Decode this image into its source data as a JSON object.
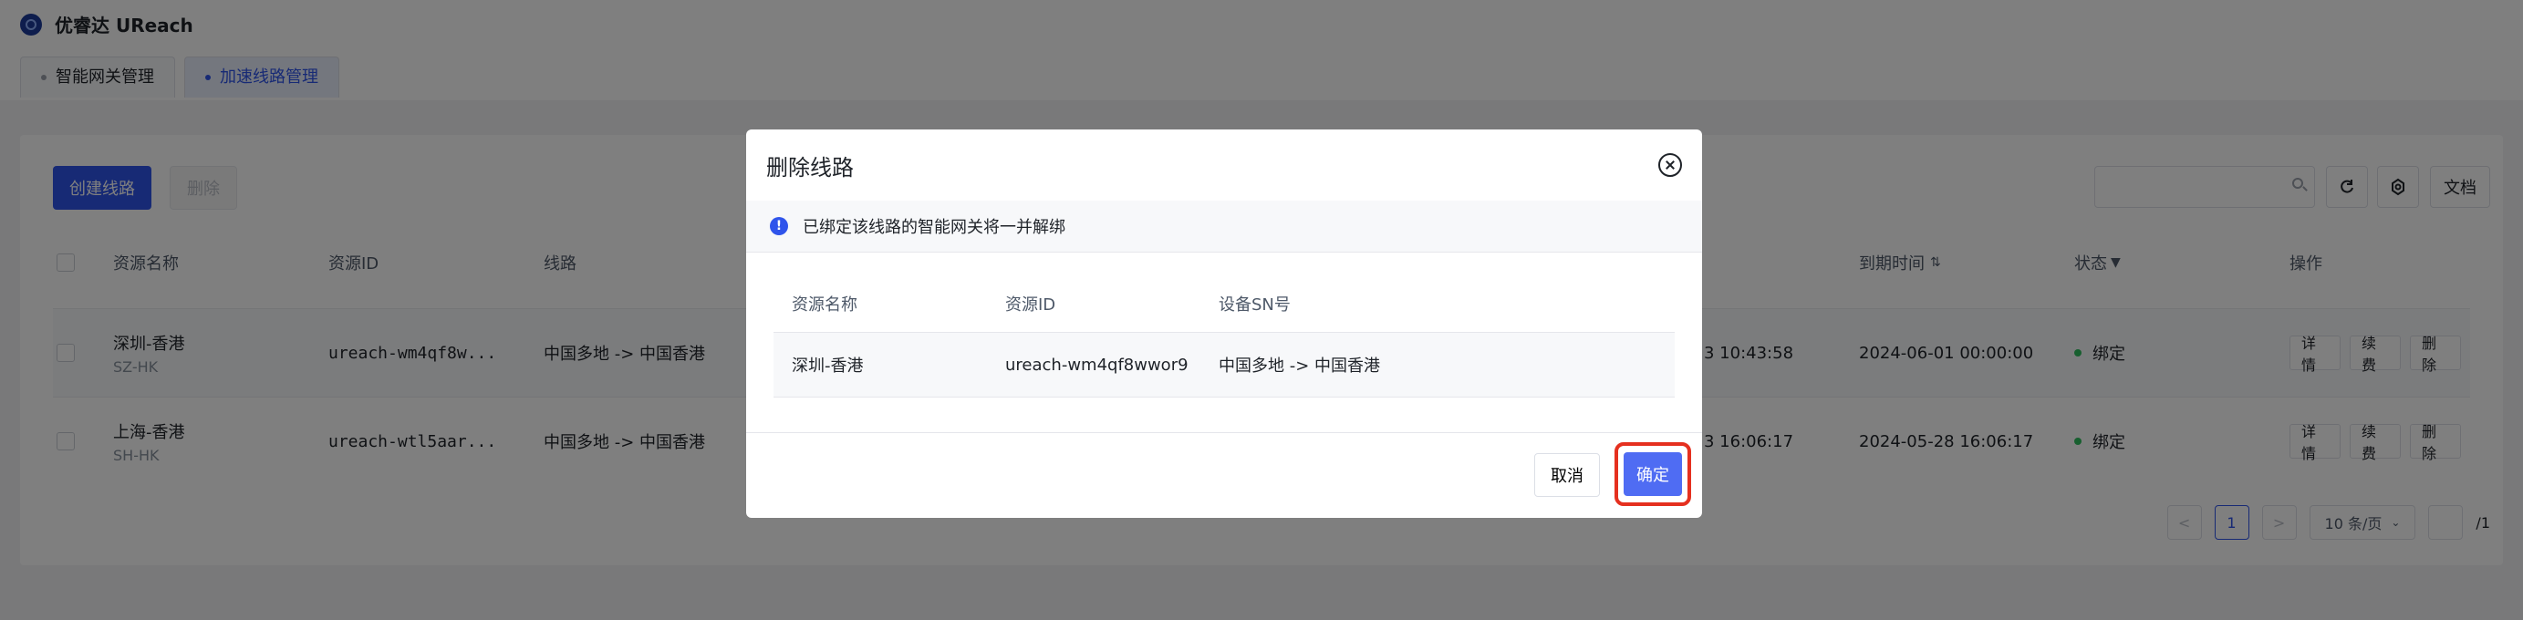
{
  "app": {
    "name": "优睿达 UReach"
  },
  "tabs": [
    {
      "label": "智能网关管理",
      "active": false
    },
    {
      "label": "加速线路管理",
      "active": true
    }
  ],
  "toolbar": {
    "create_label": "创建线路",
    "delete_label": "删除",
    "search_placeholder": "",
    "doc_label": "文档"
  },
  "table": {
    "headers": {
      "name": "资源名称",
      "id": "资源ID",
      "line": "线路",
      "expire": "到期时间",
      "status": "状态",
      "actions": "操作"
    },
    "rows": [
      {
        "name": "深圳-香港",
        "sub": "SZ-HK",
        "id": "ureach-wm4qf8w...",
        "line": "中国多地 -> 中国香港",
        "time_partial": "3 10:43:58",
        "expire": "2024-06-01 00:00:00",
        "status": "绑定"
      },
      {
        "name": "上海-香港",
        "sub": "SH-HK",
        "id": "ureach-wtl5aar...",
        "line": "中国多地 -> 中国香港",
        "time_partial": "3 16:06:17",
        "expire": "2024-05-28 16:06:17",
        "status": "绑定"
      }
    ],
    "row_actions": {
      "detail": "详情",
      "renew": "续费",
      "delete": "删除"
    }
  },
  "pagination": {
    "prev": "<",
    "current": "1",
    "next": ">",
    "page_size": "10 条/页",
    "total_pages": "/1"
  },
  "modal": {
    "title": "删除线路",
    "alert": "已绑定该线路的智能网关将一并解绑",
    "headers": {
      "name": "资源名称",
      "id": "资源ID",
      "sn": "设备SN号"
    },
    "row": {
      "name": "深圳-香港",
      "id": "ureach-wm4qf8wwor9",
      "sn": "中国多地 -> 中国香港"
    },
    "cancel_label": "取消",
    "confirm_label": "确定",
    "highlight_color": "#e5301f"
  },
  "colors": {
    "primary": "#2f54eb",
    "status_ok": "#2fbe5e"
  }
}
